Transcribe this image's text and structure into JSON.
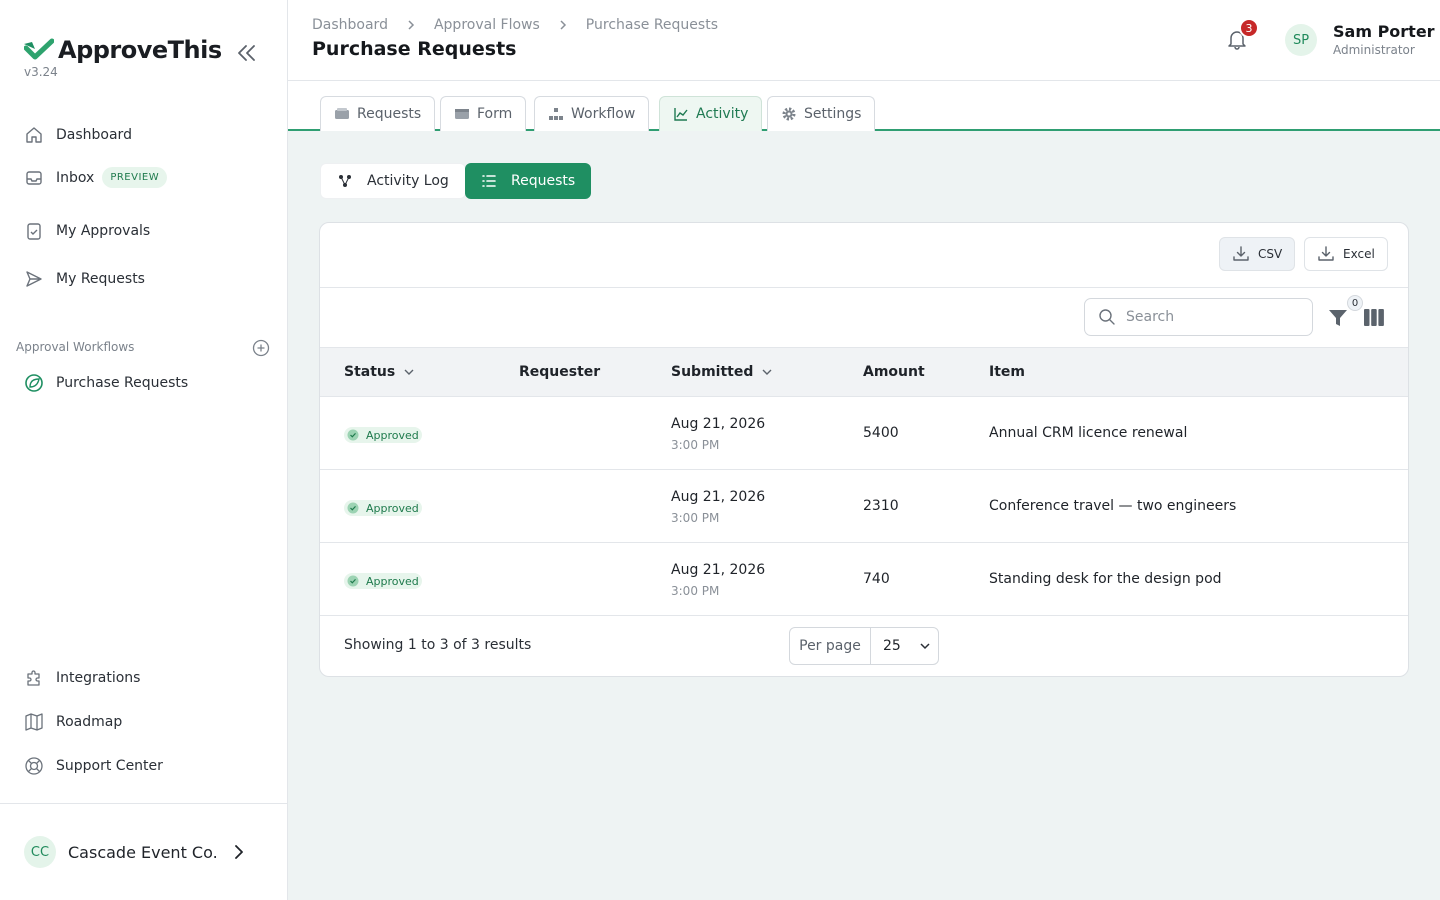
{
  "app": {
    "name": "ApproveThis",
    "version": "v3.24"
  },
  "sidebar": {
    "nav": [
      {
        "label": "Dashboard"
      },
      {
        "label": "Inbox",
        "badge": "PREVIEW"
      },
      {
        "label": "My Approvals"
      },
      {
        "label": "My Requests"
      }
    ],
    "workflows_title": "Approval Workflows",
    "workflows": [
      {
        "label": "Purchase Requests"
      }
    ],
    "footer_links": [
      {
        "label": "Integrations"
      },
      {
        "label": "Roadmap"
      },
      {
        "label": "Support Center"
      }
    ],
    "org": {
      "initials": "CC",
      "name": "Cascade Event Co."
    }
  },
  "header": {
    "breadcrumbs": [
      "Dashboard",
      "Approval Flows",
      "Purchase Requests"
    ],
    "title": "Purchase Requests",
    "notifications_count": "3",
    "user": {
      "initials": "SP",
      "name": "Sam Porter",
      "role": "Administrator"
    }
  },
  "tabs": [
    {
      "label": "Requests",
      "icon": "inbox-icon"
    },
    {
      "label": "Form",
      "icon": "form-icon"
    },
    {
      "label": "Workflow",
      "icon": "workflow-icon"
    },
    {
      "label": "Activity",
      "icon": "chart-line-icon",
      "active": true
    },
    {
      "label": "Settings",
      "icon": "gear-icon"
    }
  ],
  "subview": {
    "activity_log": "Activity Log",
    "requests": "Requests",
    "active": "Requests"
  },
  "exports": {
    "csv": "CSV",
    "excel": "Excel"
  },
  "search": {
    "placeholder": "Search",
    "value": ""
  },
  "filter_count": "0",
  "table": {
    "columns": [
      "Status",
      "Requester",
      "Submitted",
      "Amount",
      "Item"
    ],
    "rows": [
      {
        "status": "Approved",
        "requester": "",
        "date": "Aug 21, 2026",
        "time": "3:00 PM",
        "amount": "5400",
        "item": "Annual CRM licence renewal"
      },
      {
        "status": "Approved",
        "requester": "",
        "date": "Aug 21, 2026",
        "time": "3:00 PM",
        "amount": "2310",
        "item": "Conference travel — two engineers"
      },
      {
        "status": "Approved",
        "requester": "",
        "date": "Aug 21, 2026",
        "time": "3:00 PM",
        "amount": "740",
        "item": "Standing desk for the design pod"
      }
    ]
  },
  "pagination": {
    "summary": "Showing 1 to 3 of 3 results",
    "per_page_label": "Per page",
    "per_page_value": "25"
  },
  "colors": {
    "brand": "#1f8f62",
    "accent_light": "#e7f5ec",
    "danger": "#c62828"
  }
}
